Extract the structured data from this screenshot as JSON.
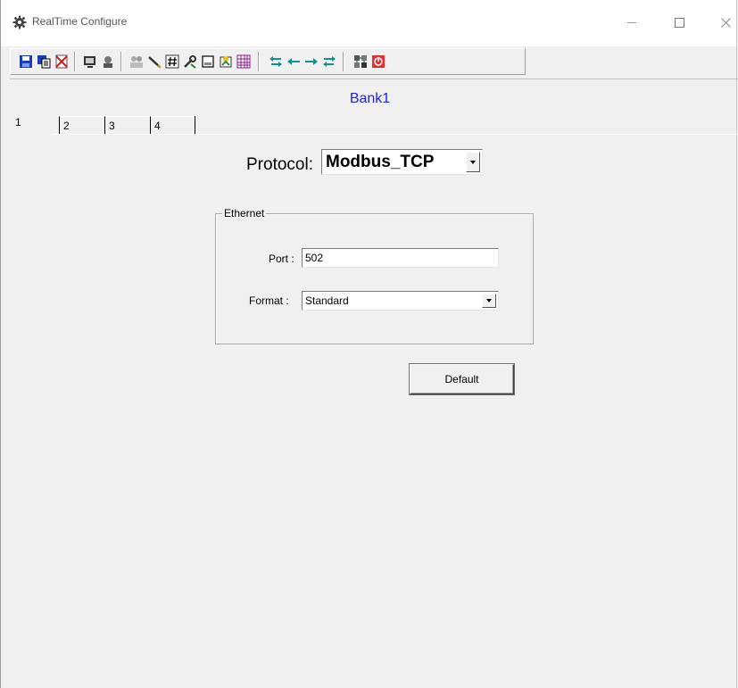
{
  "window": {
    "title": "RealTime Configure",
    "icon": "gear-app-icon"
  },
  "toolbar": {
    "buttons": [
      {
        "icon": "save-icon",
        "color": "#1a3fb5"
      },
      {
        "icon": "save-as-icon",
        "color": "#1a3fb5"
      },
      {
        "icon": "delete-icon",
        "color": "#d11c1c"
      },
      {
        "icon": "monitor-icon",
        "color": "#333333"
      },
      {
        "icon": "connect-icon",
        "color": "#555555"
      },
      {
        "icon": "users-icon",
        "color": "#888888"
      },
      {
        "icon": "pen-icon",
        "color": "#333333"
      },
      {
        "icon": "number-icon",
        "color": "#333333"
      },
      {
        "icon": "tools-icon",
        "color": "#333333"
      },
      {
        "icon": "window-icon",
        "color": "#333333"
      },
      {
        "icon": "wizard-icon",
        "color": "#2e8b57"
      },
      {
        "icon": "grid-icon",
        "color": "#8b1a8b"
      },
      {
        "icon": "transfer-both-icon",
        "color": "#12908e"
      },
      {
        "icon": "arrow-left-icon",
        "color": "#12908e"
      },
      {
        "icon": "arrow-right-icon",
        "color": "#12908e"
      },
      {
        "icon": "transfer-reverse-icon",
        "color": "#12908e"
      },
      {
        "icon": "network-icon",
        "color": "#333333"
      },
      {
        "icon": "exit-icon",
        "color": "#e03030"
      }
    ]
  },
  "heading": "Bank1",
  "tabs": [
    {
      "label": "1",
      "active": true
    },
    {
      "label": "2",
      "active": false
    },
    {
      "label": "3",
      "active": false
    },
    {
      "label": "4",
      "active": false
    }
  ],
  "protocol": {
    "label": "Protocol:",
    "value": "Modbus_TCP"
  },
  "ethernet": {
    "group_title": "Ethernet",
    "port_label": "Port :",
    "port_value": "502",
    "format_label": "Format :",
    "format_value": "Standard"
  },
  "default_button": "Default",
  "colors": {
    "heading": "#2222e6",
    "background": "#f0f0f0"
  }
}
